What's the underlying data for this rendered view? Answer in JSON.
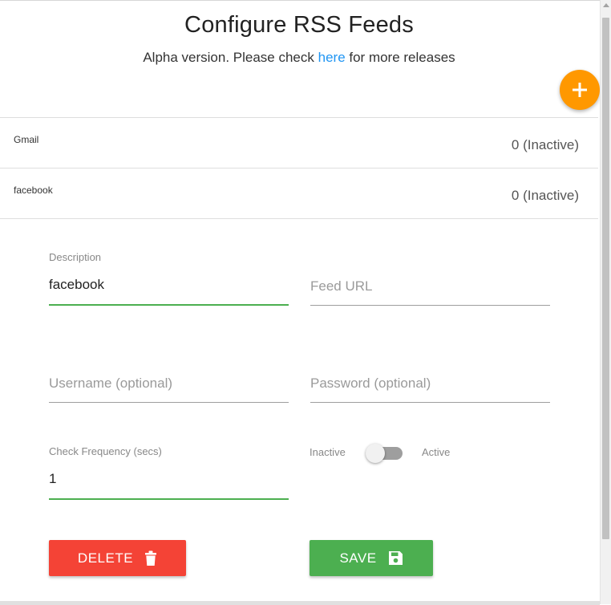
{
  "header": {
    "title": "Configure RSS Feeds",
    "subtitle_prefix": "Alpha version. Please check ",
    "subtitle_link": "here",
    "subtitle_suffix": " for more releases"
  },
  "add_button": {
    "icon": "plus-icon",
    "color": "#ff9800"
  },
  "feeds": [
    {
      "name": "Gmail",
      "status": "0 (Inactive)"
    },
    {
      "name": "facebook",
      "status": "0 (Inactive)"
    }
  ],
  "form": {
    "description": {
      "label": "Description",
      "value": "facebook"
    },
    "feed_url": {
      "placeholder": "Feed URL"
    },
    "username": {
      "placeholder": "Username (optional)"
    },
    "password": {
      "placeholder": "Password (optional)"
    },
    "check_frequency": {
      "label": "Check Frequency (secs)",
      "value": "1"
    },
    "toggle": {
      "off_label": "Inactive",
      "on_label": "Active",
      "state": "off"
    }
  },
  "actions": {
    "delete_label": "DELETE",
    "delete_icon": "trash-icon",
    "delete_color": "#f44336",
    "save_label": "SAVE",
    "save_icon": "floppy-disk-icon",
    "save_color": "#4caf50"
  },
  "colors": {
    "accent": "#4caf50",
    "link": "#2196f3"
  }
}
